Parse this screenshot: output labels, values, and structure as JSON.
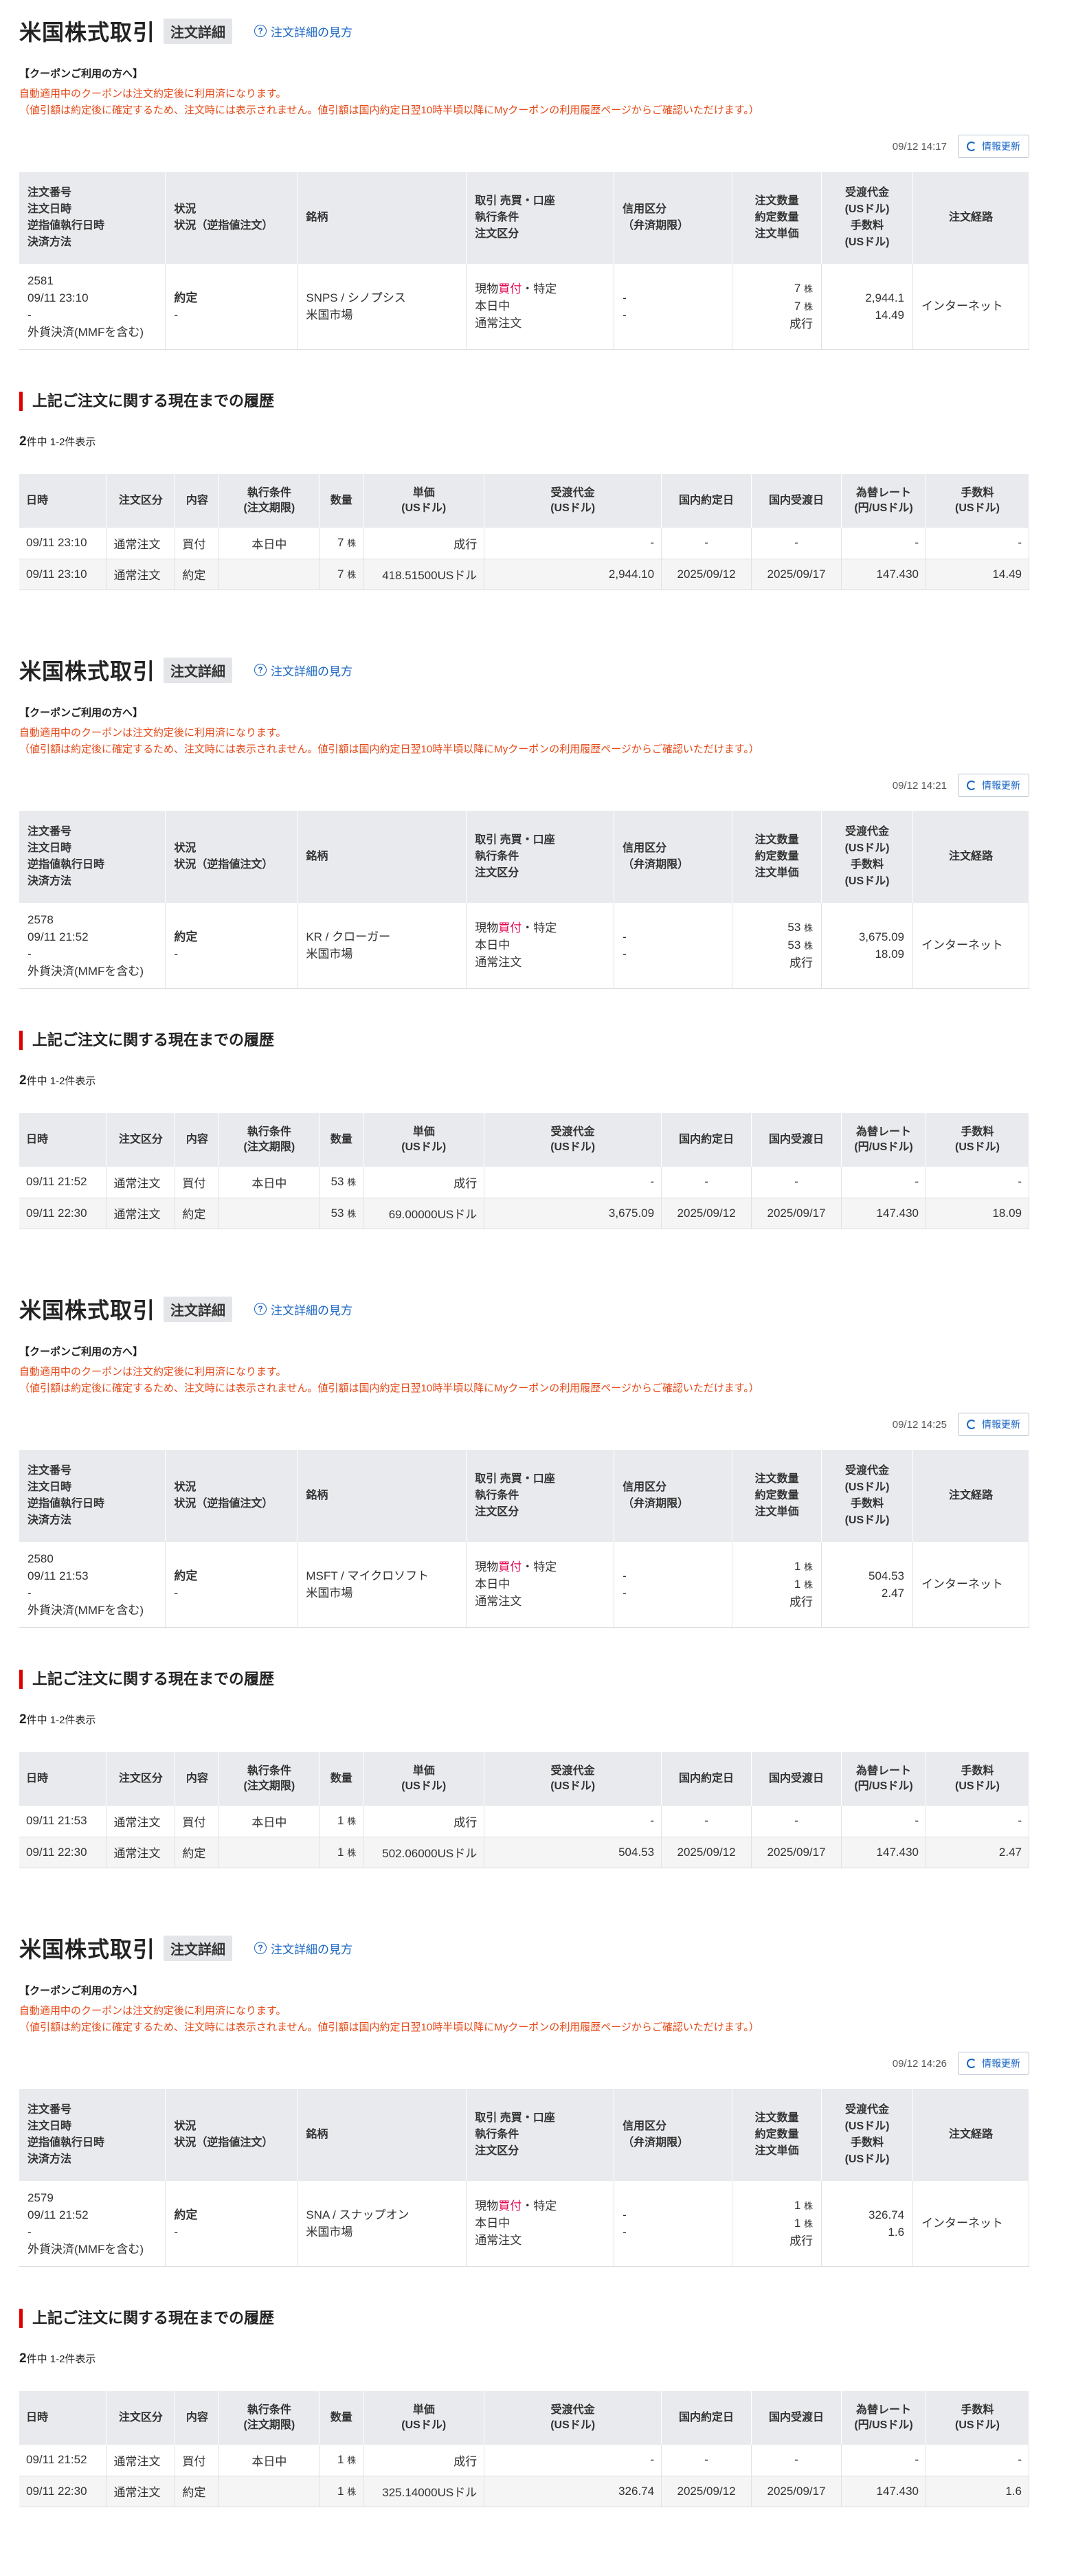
{
  "page": {
    "title": "米国株式取引",
    "badge": "注文詳細",
    "help_link": "注文詳細の見方",
    "coupon_head": "【クーポンご利用の方へ】",
    "refresh_label": "情報更新",
    "history_title": "上記ご注文に関する現在までの履歴",
    "count_total": "2",
    "count_rest": "件中 1-2件表示",
    "share_unit": "株",
    "order_headers": {
      "col1": [
        "注文番号",
        "注文日時",
        "逆指値執行日時",
        "決済方法"
      ],
      "col2": [
        "状況",
        "状況（逆指値注文）"
      ],
      "col3": [
        "銘柄"
      ],
      "col4": [
        "取引 売買・口座",
        "執行条件",
        "注文区分"
      ],
      "col5": [
        "信用区分",
        "（弁済期限）"
      ],
      "col6": [
        "注文数量",
        "約定数量",
        "注文単価"
      ],
      "col7": [
        "受渡代金",
        "(USドル)",
        "手数料",
        "(USドル)"
      ],
      "col8": [
        "注文経路"
      ]
    },
    "history_headers": {
      "date": "日時",
      "kind": "注文区分",
      "content": "内容",
      "cond": [
        "執行条件",
        "(注文期限)"
      ],
      "qty": "数量",
      "price": [
        "単価",
        "(USドル)"
      ],
      "amount": [
        "受渡代金",
        "(USドル)"
      ],
      "dom_date": "国内約定日",
      "settle_date": "国内受渡日",
      "fx": [
        "為替レート",
        "(円/USドル)"
      ],
      "fee": [
        "手数料",
        "(USドル)"
      ]
    }
  },
  "orders": [
    {
      "coupon_lines": [
        "自動適用中のクーポンは注文約定後に利用済になります。",
        "（値引額は約定後に確定するため、注文時には表示されません。値引額は国内約定日翌10時半頃以降にMyクーポンの利用履歴ページからご確認いただけます。）"
      ],
      "timestamp": "09/12 14:17",
      "order_no": "2581",
      "order_dt": "09/11 23:10",
      "stop_dt": "-",
      "settle_method": "外貨決済(MMFを含む)",
      "status": "約定",
      "status_stop": "-",
      "symbol": "SNPS / シノプシス",
      "market": "米国市場",
      "trade_type": "現物",
      "side": "買付",
      "account": "・特定",
      "exec_cond": "本日中",
      "order_kind": "通常注文",
      "credit1": "-",
      "credit2": "-",
      "qty_order": "7",
      "qty_filled": "7",
      "unit_price": "成行",
      "amount": "2,944.1",
      "fee": "14.49",
      "route": "インターネット",
      "history": [
        {
          "date": "09/11 23:10",
          "kind": "通常注文",
          "content": "買付",
          "cond": "本日中",
          "qty": "7",
          "price": "成行",
          "amount": "-",
          "dom_date": "-",
          "settle_date": "-",
          "fx": "-",
          "fee": "-"
        },
        {
          "date": "09/11 23:10",
          "kind": "通常注文",
          "content": "約定",
          "cond": "",
          "qty": "7",
          "price": "418.51500USドル",
          "amount": "2,944.10",
          "dom_date": "2025/09/12",
          "settle_date": "2025/09/17",
          "fx": "147.430",
          "fee": "14.49"
        }
      ]
    },
    {
      "coupon_lines": [
        "自動適用中のクーポンは注文約定後に利用済になります。",
        "（値引額は約定後に確定するため、注文時には表示されません。値引額は国内約定日翌10時半頃以降にMyクーポンの利用履歴ページからご確認いただけます。）"
      ],
      "timestamp": "09/12 14:21",
      "order_no": "2578",
      "order_dt": "09/11 21:52",
      "stop_dt": "-",
      "settle_method": "外貨決済(MMFを含む)",
      "status": "約定",
      "status_stop": "-",
      "symbol": "KR / クローガー",
      "market": "米国市場",
      "trade_type": "現物",
      "side": "買付",
      "account": "・特定",
      "exec_cond": "本日中",
      "order_kind": "通常注文",
      "credit1": "-",
      "credit2": "-",
      "qty_order": "53",
      "qty_filled": "53",
      "unit_price": "成行",
      "amount": "3,675.09",
      "fee": "18.09",
      "route": "インターネット",
      "history": [
        {
          "date": "09/11 21:52",
          "kind": "通常注文",
          "content": "買付",
          "cond": "本日中",
          "qty": "53",
          "price": "成行",
          "amount": "-",
          "dom_date": "-",
          "settle_date": "-",
          "fx": "-",
          "fee": "-"
        },
        {
          "date": "09/11 22:30",
          "kind": "通常注文",
          "content": "約定",
          "cond": "",
          "qty": "53",
          "price": "69.00000USドル",
          "amount": "3,675.09",
          "dom_date": "2025/09/12",
          "settle_date": "2025/09/17",
          "fx": "147.430",
          "fee": "18.09"
        }
      ]
    },
    {
      "coupon_lines": [
        "自動適用中のクーポンは注文約定後に利用済になります。",
        "（値引額は約定後に確定するため、注文時には表示されません。値引額は国内約定日翌10時半頃以降にMyクーポンの利用履歴ページからご確認いただけます。）"
      ],
      "timestamp": "09/12 14:25",
      "order_no": "2580",
      "order_dt": "09/11 21:53",
      "stop_dt": "-",
      "settle_method": "外貨決済(MMFを含む)",
      "status": "約定",
      "status_stop": "-",
      "symbol": "MSFT / マイクロソフト",
      "market": "米国市場",
      "trade_type": "現物",
      "side": "買付",
      "account": "・特定",
      "exec_cond": "本日中",
      "order_kind": "通常注文",
      "credit1": "-",
      "credit2": "-",
      "qty_order": "1",
      "qty_filled": "1",
      "unit_price": "成行",
      "amount": "504.53",
      "fee": "2.47",
      "route": "インターネット",
      "history": [
        {
          "date": "09/11 21:53",
          "kind": "通常注文",
          "content": "買付",
          "cond": "本日中",
          "qty": "1",
          "price": "成行",
          "amount": "-",
          "dom_date": "-",
          "settle_date": "-",
          "fx": "-",
          "fee": "-"
        },
        {
          "date": "09/11 22:30",
          "kind": "通常注文",
          "content": "約定",
          "cond": "",
          "qty": "1",
          "price": "502.06000USドル",
          "amount": "504.53",
          "dom_date": "2025/09/12",
          "settle_date": "2025/09/17",
          "fx": "147.430",
          "fee": "2.47"
        }
      ]
    },
    {
      "coupon_lines": [
        "自動適用中のクーポンは注文約定後に利用済になります。",
        "（値引額は約定後に確定するため、注文時には表示されません。値引額は国内約定日翌10時半頃以降にMyクーポンの利用履歴ページからご確認いただけます。）"
      ],
      "timestamp": "09/12 14:26",
      "order_no": "2579",
      "order_dt": "09/11 21:52",
      "stop_dt": "-",
      "settle_method": "外貨決済(MMFを含む)",
      "status": "約定",
      "status_stop": "-",
      "symbol": "SNA / スナップオン",
      "market": "米国市場",
      "trade_type": "現物",
      "side": "買付",
      "account": "・特定",
      "exec_cond": "本日中",
      "order_kind": "通常注文",
      "credit1": "-",
      "credit2": "-",
      "qty_order": "1",
      "qty_filled": "1",
      "unit_price": "成行",
      "amount": "326.74",
      "fee": "1.6",
      "route": "インターネット",
      "history": [
        {
          "date": "09/11 21:52",
          "kind": "通常注文",
          "content": "買付",
          "cond": "本日中",
          "qty": "1",
          "price": "成行",
          "amount": "-",
          "dom_date": "-",
          "settle_date": "-",
          "fx": "-",
          "fee": "-"
        },
        {
          "date": "09/11 22:30",
          "kind": "通常注文",
          "content": "約定",
          "cond": "",
          "qty": "1",
          "price": "325.14000USドル",
          "amount": "326.74",
          "dom_date": "2025/09/12",
          "settle_date": "2025/09/17",
          "fx": "147.430",
          "fee": "1.6"
        }
      ]
    }
  ]
}
